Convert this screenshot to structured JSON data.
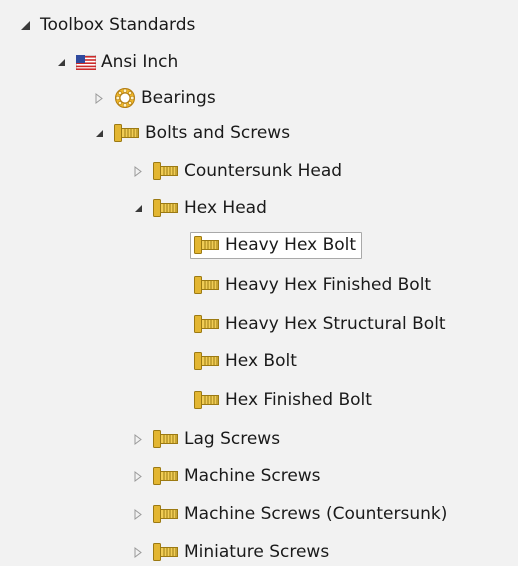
{
  "tree": {
    "root": "Toolbox Standards",
    "standard": "Ansi Inch",
    "bearings": "Bearings",
    "bolts_and_screws": "Bolts and Screws",
    "countersunk_head": "Countersunk Head",
    "hex_head": "Hex Head",
    "hex_items": [
      "Heavy Hex Bolt",
      "Heavy Hex Finished Bolt",
      "Heavy Hex Structural Bolt",
      "Hex Bolt",
      "Hex Finished Bolt"
    ],
    "lag_screws": "Lag Screws",
    "machine_screws": "Machine Screws",
    "machine_screws_countersunk": "Machine Screws (Countersunk)",
    "miniature_screws": "Miniature Screws",
    "selected_item": "Heavy Hex Bolt"
  },
  "icons": {
    "expanded": "expanded-arrow-icon",
    "collapsed": "collapsed-arrow-icon",
    "flag": "us-flag-icon",
    "bearing": "bearing-icon",
    "bolt": "bolt-icon"
  },
  "colors": {
    "background": "#f2f2f2",
    "selection_border": "#a9a9a9",
    "bolt_gold": "#e3b632",
    "bearing_gold": "#f0b828"
  }
}
